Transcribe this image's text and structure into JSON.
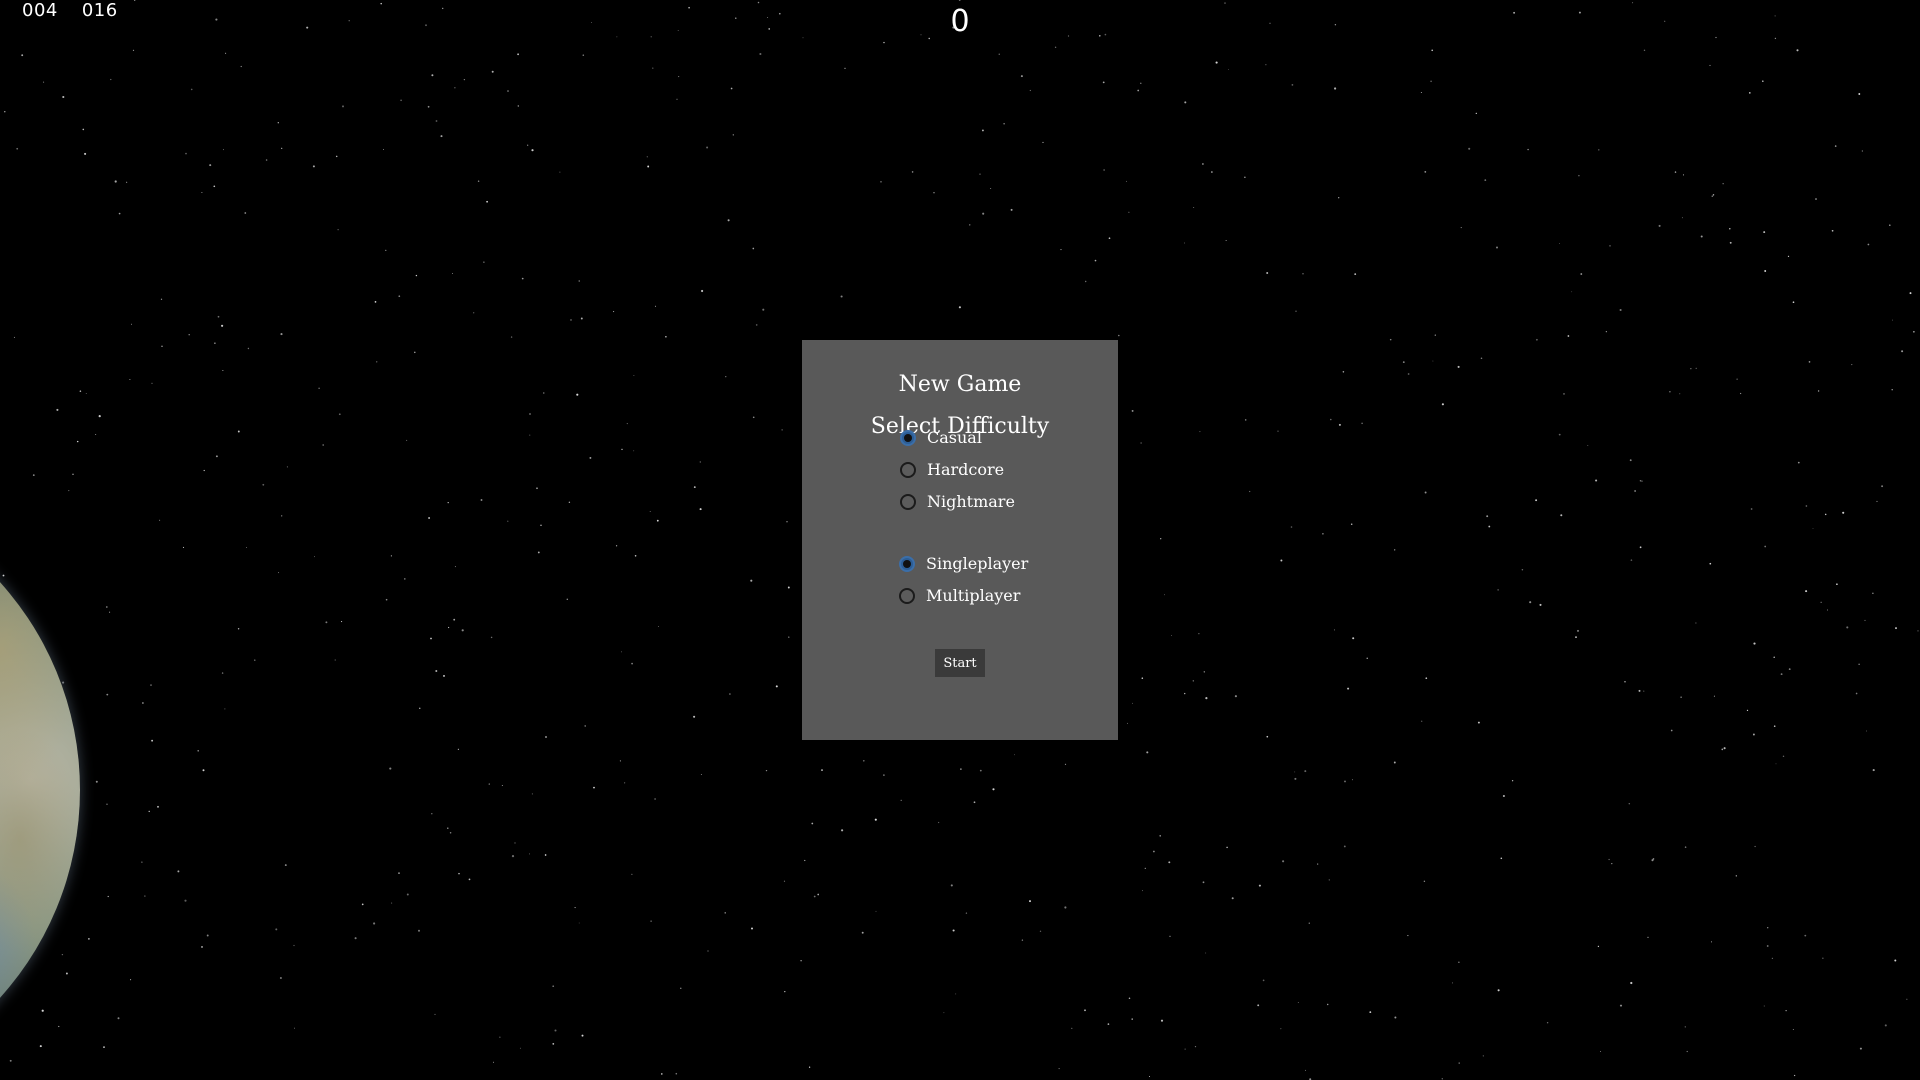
{
  "hud": {
    "counter_a": "004",
    "counter_b": "016",
    "score": "0"
  },
  "dialog": {
    "title": "New Game",
    "difficulty_heading": "Select Difficulty",
    "difficulty_options": [
      {
        "label": "Casual",
        "selected": true
      },
      {
        "label": "Hardcore",
        "selected": false
      },
      {
        "label": "Nightmare",
        "selected": false
      }
    ],
    "mode_options": [
      {
        "label": "Singleplayer",
        "selected": true
      },
      {
        "label": "Multiplayer",
        "selected": false
      }
    ],
    "start_label": "Start"
  },
  "colors": {
    "background": "#000000",
    "dialog_background": "#595959",
    "radio_selected": "#2c5d95",
    "start_button": "#3a3a3a"
  }
}
